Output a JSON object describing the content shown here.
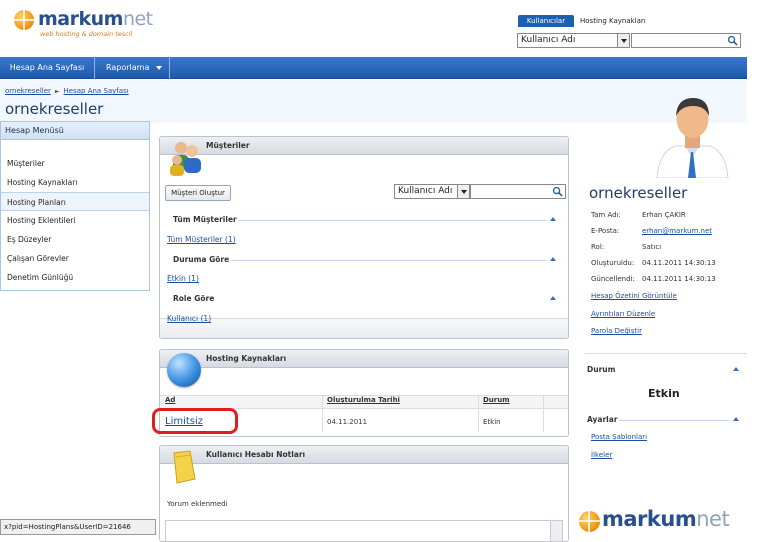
{
  "header": {
    "logo": {
      "brand": "markum",
      "brand_suffix": "net",
      "tagline": "web hosting & domain tescil"
    },
    "tabs": [
      {
        "label": "Kullanıcılar",
        "active": true
      },
      {
        "label": "Hosting Kaynakları",
        "active": false
      }
    ],
    "search": {
      "select_value": "Kullanıcı Adı",
      "input_value": ""
    }
  },
  "nav": {
    "home": "Hesap Ana Sayfası",
    "reports": "Raporlama"
  },
  "breadcrumb": {
    "item1": "ornekreseller",
    "item2": "Hesap Ana Sayfası"
  },
  "page_title": "ornekreseller",
  "left_menu": {
    "title": "Hesap Menüsü",
    "items": [
      {
        "label": "Müşteriler"
      },
      {
        "label": "Hosting Kaynakları"
      },
      {
        "label": "Hosting Planları",
        "active": true
      },
      {
        "label": "Hosting Eklentileri"
      },
      {
        "label": "Eş Düzeyler"
      },
      {
        "label": "Çalışan Görevler"
      },
      {
        "label": "Denetim Günlüğü"
      }
    ]
  },
  "customers": {
    "title": "Müşteriler",
    "create_button": "Müşteri Oluştur",
    "search_select": "Kullanıcı Adı",
    "search_value": "",
    "sections": [
      {
        "title": "Tüm Müşteriler",
        "link": "Tüm Müşteriler (1)"
      },
      {
        "title": "Duruma Göre",
        "link": "Etkin (1)"
      },
      {
        "title": "Role Göre",
        "link": "Kullanıcı (1)"
      }
    ]
  },
  "hosting": {
    "title": "Hosting Kaynakları",
    "columns": [
      "Ad",
      "Oluşturulma Tarihi",
      "Durum"
    ],
    "rows": [
      {
        "name": "Limitsiz",
        "created": "04.11.2011",
        "status": "Etkin"
      }
    ]
  },
  "notes": {
    "title": "Kullanıcı Hesabı Notları",
    "empty_text": "Yorum eklenmedi"
  },
  "profile": {
    "name": "ornekreseller",
    "fields": [
      {
        "label": "Tam Adı:",
        "value": "Erhan ÇAKIR"
      },
      {
        "label": "E-Posta:",
        "value": "erhan@markum.net",
        "is_link": true
      },
      {
        "label": "Rol:",
        "value": "Satıcı"
      },
      {
        "label": "Oluşturuldu:",
        "value": "04.11.2011 14:30:13"
      },
      {
        "label": "Güncellendi:",
        "value": "04.11.2011 14:30:13"
      }
    ],
    "links": [
      "Hesap Özetini Görüntüle",
      "Ayrıntıları Düzenle",
      "Parola Değiştir"
    ]
  },
  "status_box": {
    "title": "Durum",
    "value": "Etkin"
  },
  "settings_box": {
    "title": "Ayarlar",
    "links": [
      "Posta Şablonları",
      "İlkeler"
    ]
  },
  "status_bar": "x?pid=HostingPlans&UserID=21646",
  "footer_logo": {
    "brand": "markum",
    "brand_suffix": "net"
  },
  "colors": {
    "nav_blue": "#1d59ab",
    "link_blue": "#1a4fa8",
    "highlight_red": "#dd1f1f",
    "logo_orange": "#f29a1a"
  }
}
